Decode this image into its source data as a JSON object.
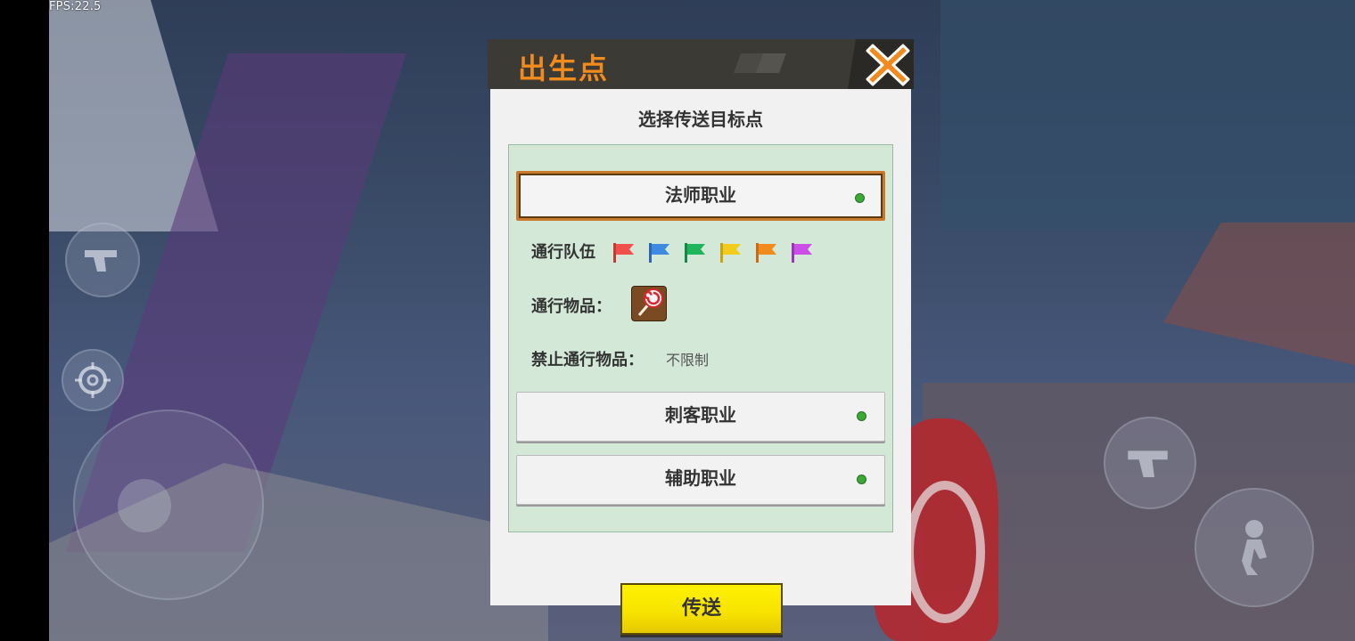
{
  "hud": {
    "fps": "FPS:22.5"
  },
  "dialog": {
    "title": "出生点",
    "subtitle": "选择传送目标点",
    "options": [
      {
        "label": "法师职业",
        "selected": true,
        "teams_label": "通行队伍",
        "team_flags": [
          "red",
          "blue",
          "green",
          "yellow",
          "orange",
          "purple"
        ],
        "items_label": "通行物品：",
        "item_icon": "lollipop-icon",
        "forbidden_label": "禁止通行物品：",
        "forbidden_value": "不限制"
      },
      {
        "label": "刺客职业",
        "selected": false
      },
      {
        "label": "辅助职业",
        "selected": false
      }
    ],
    "send_label": "传送"
  },
  "colors": {
    "title": "#f28b1d",
    "panel": "#d3e8d6",
    "send_button": "#f6e200",
    "status_dot": "#3aaa35",
    "flag_red": "#f2504b",
    "flag_blue": "#3f8ae0",
    "flag_green": "#20b55c",
    "flag_yellow": "#f2cc1d",
    "flag_orange": "#f28b1d",
    "flag_purple": "#c94fe6"
  }
}
